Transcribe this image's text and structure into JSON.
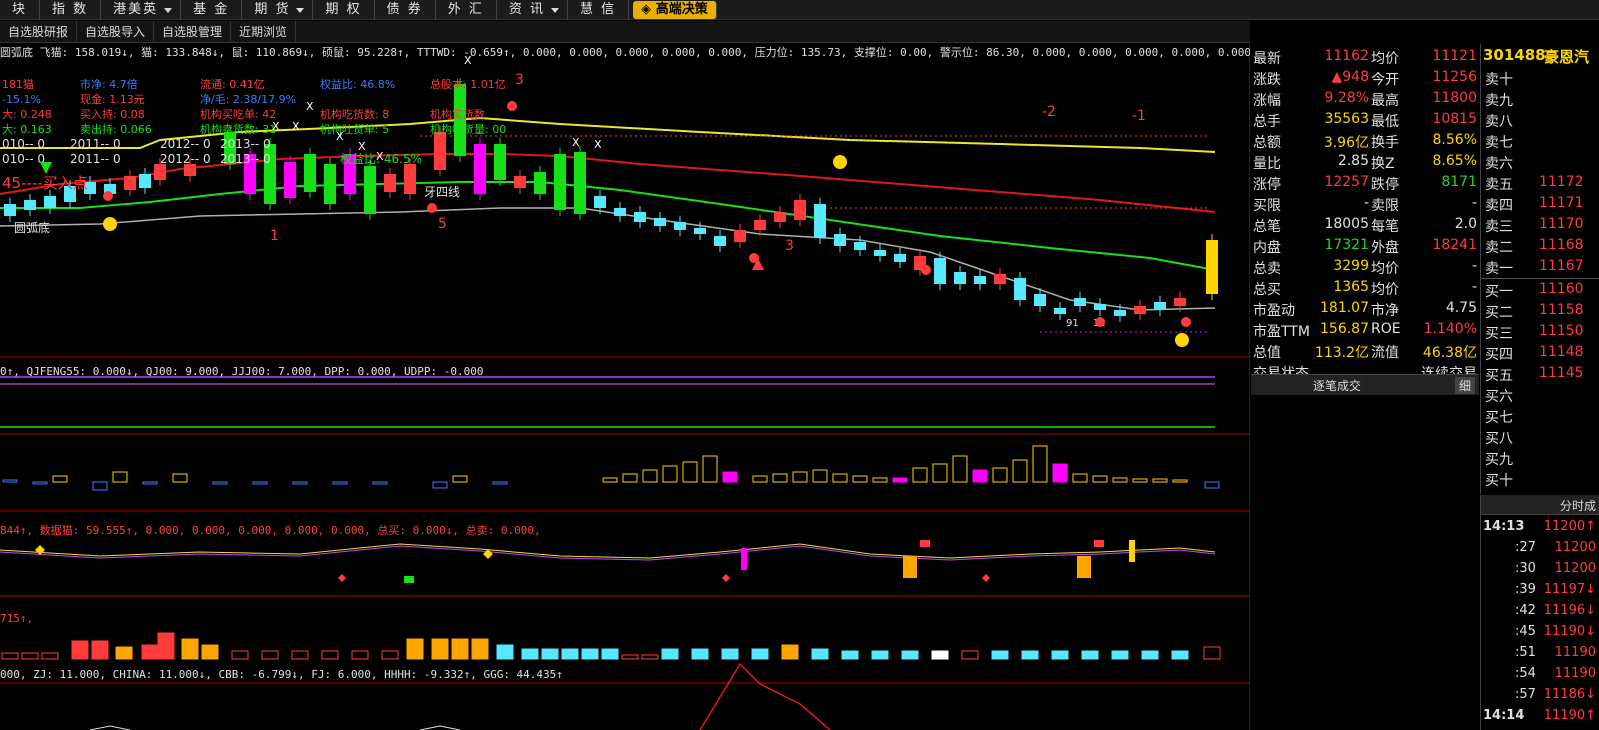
{
  "menu": {
    "items": [
      "块",
      "指 数",
      "港美英",
      "基 金",
      "期 货",
      "期 权",
      "债 券",
      "外 汇",
      "资 讯",
      "慧 信"
    ],
    "highlight": "高端决策"
  },
  "subtabs": [
    "自选股研报",
    "自选股导入",
    "自选股管理",
    "近期浏览"
  ],
  "indicator_bar_main": "圆弧底 飞猫: 158.019↓, 猫: 133.848↓, 鼠: 110.869↓, 硕鼠: 95.228↑, TTTWD: -0.659↑, 0.000, 0.000, 0.000, 0.000, 0.000, 压力位: 135.73, 支撑位: 0.00, 警示位: 86.30, 0.000, 0.000, 0.000, 0.000, 0.000, 0.000",
  "bar2": "0↑, QJFENG55: 0.000↓, QJ00: 9.000, JJJ00: 7.000, DPP: 0.000, UDPP: -0.000",
  "bar3": "844↑, 数据猫: 59.555↑, 0.000, 0.000, 0.000, 0.000, 0.000, 总买: 0.000↓, 总卖: 0.000,",
  "bar4": "715↑,",
  "bar5": "000, ZJ: 11.000, CHINA: 11.000↓, CBB: -6.799↓, FJ: 6.000, HHHH: -9.332↑, GGG: 44.435↑",
  "overlay": {
    "l1": [
      "181猫",
      "市净: 4.7倍",
      "流通: 0.41亿",
      "权益比: 46.8%",
      "总股本: 1.01亿"
    ],
    "l2": [
      "-15.1%",
      "现金: 1.13元",
      "净/毛: 2.38/17.9%"
    ],
    "l3": [
      "大: 0.248",
      "买入持: 0.08",
      "机构买吃单: 42",
      "机构吃货数: 8",
      "机构实货数"
    ],
    "l4": [
      "大: 0.163",
      "卖出持: 0.066",
      "机构卖货数: 31",
      "机构吐货单: 5",
      "机构吐货量: 00"
    ],
    "l5": [
      "010-- 0",
      "2011-- 0",
      "2012-- 0",
      "2013-- 0"
    ],
    "l6": [
      "010-- 0",
      "2011-- 0",
      "2012-- 0",
      "2013-- 0",
      "权益比: 46.5%"
    ],
    "lbl45": "45----买入点",
    "yuanhudi": "圆弧底",
    "jianshuang": "见顶精华",
    "yasixian": "牙四线",
    "n1": "1",
    "n5": "5",
    "n3": "3",
    "nm2": "-2",
    "nm1": "-1",
    "n_3": "3",
    "n_91": "91",
    "n_12": "12",
    "chaodi": "抄底",
    "x": "X"
  },
  "quote": {
    "code": "301488",
    "name": "豪恩汽",
    "rows": [
      [
        "最新",
        "11162",
        "均价",
        "11121"
      ],
      [
        "涨跌",
        "▲948",
        "今开",
        "11256"
      ],
      [
        "涨幅",
        "9.28%",
        "最高",
        "11800"
      ],
      [
        "总手",
        "35563",
        "最低",
        "10815"
      ],
      [
        "总额",
        "3.96亿",
        "换手",
        "8.56%"
      ],
      [
        "量比",
        "2.85",
        "换Z",
        "8.65%"
      ],
      [
        "涨停",
        "12257",
        "跌停",
        "8171"
      ],
      [
        "买限",
        "-",
        "卖限",
        "-"
      ],
      [
        "总笔",
        "18005",
        "每笔",
        "2.0"
      ],
      [
        "内盘",
        "17321",
        "外盘",
        "18241"
      ],
      [
        "总卖",
        "3299",
        "均价",
        "-"
      ],
      [
        "总买",
        "1365",
        "均价",
        "-"
      ],
      [
        "市盈动",
        "181.07",
        "市净",
        "4.75"
      ],
      [
        "市盈TTM",
        "156.87",
        "ROE",
        "1.140%"
      ],
      [
        "总值",
        "113.2亿",
        "流值",
        "46.38亿"
      ],
      [
        "交易状态",
        "",
        "",
        "连续交易"
      ]
    ],
    "trades_tab": "逐笔成交",
    "detail_tab": "细"
  },
  "orderbook": {
    "asks": [
      [
        "卖十",
        ""
      ],
      [
        "卖九",
        ""
      ],
      [
        "卖八",
        ""
      ],
      [
        "卖七",
        ""
      ],
      [
        "卖六",
        ""
      ],
      [
        "卖五",
        "11172"
      ],
      [
        "卖四",
        "11171"
      ],
      [
        "卖三",
        "11170"
      ],
      [
        "卖二",
        "11168"
      ],
      [
        "卖一",
        "11167"
      ]
    ],
    "bids": [
      [
        "买一",
        "11160"
      ],
      [
        "买二",
        "11158"
      ],
      [
        "买三",
        "11150"
      ],
      [
        "买四",
        "11148"
      ],
      [
        "买五",
        "11145"
      ],
      [
        "买六",
        ""
      ],
      [
        "买七",
        ""
      ],
      [
        "买八",
        ""
      ],
      [
        "买九",
        ""
      ],
      [
        "买十",
        ""
      ]
    ]
  },
  "ticks": {
    "tab": "分时成",
    "rows": [
      [
        "14:13",
        "11200↑"
      ],
      [
        ":27",
        "11200"
      ],
      [
        ":30",
        "11200"
      ],
      [
        ":39",
        "11197↓"
      ],
      [
        ":42",
        "11196↓"
      ],
      [
        ":45",
        "11190↓"
      ],
      [
        ":51",
        "11190"
      ],
      [
        ":54",
        "11190"
      ],
      [
        ":57",
        "11186↓"
      ],
      [
        "14:14",
        "11190↑"
      ]
    ]
  },
  "colors": {
    "up": "#ff3b3b",
    "down": "#2bd32b",
    "yellow": "#ffd400",
    "cyan": "#55e8ff",
    "magenta": "#ff00ff",
    "ma_yellow": "#e8e830",
    "ma_red": "#e01818",
    "ma_green": "#18e018",
    "ma_gray": "#b0b0b0",
    "sep": "#b00000"
  }
}
